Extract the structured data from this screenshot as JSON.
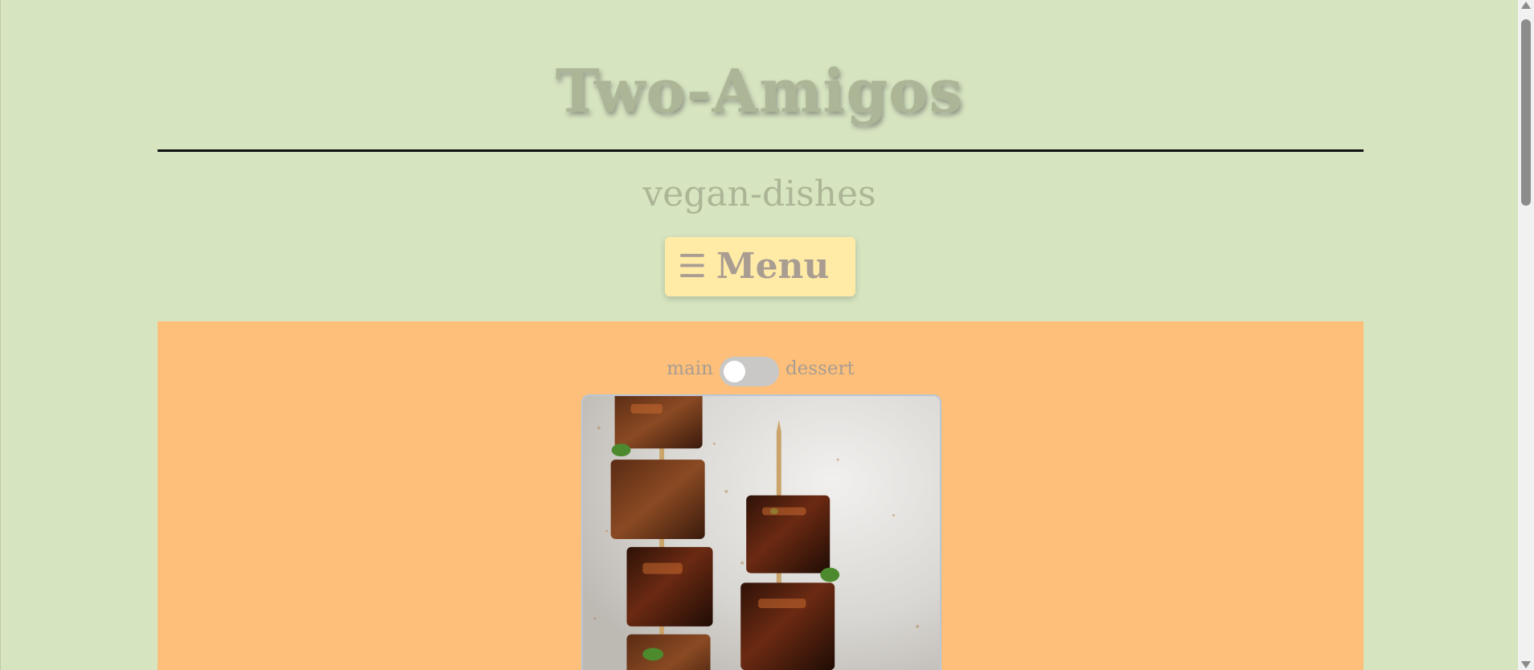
{
  "header": {
    "title": "Two-Amigos",
    "subtitle": "vegan-dishes"
  },
  "nav": {
    "menu_icon": "☰",
    "menu_label": "Menu"
  },
  "category_toggle": {
    "left_label": "main",
    "right_label": "dessert",
    "checked": false
  },
  "dish": {
    "image": "grilled-tofu-skewers-photo"
  },
  "colors": {
    "page_background": "#d6e4c0",
    "content_background": "#fdbf79",
    "menu_button_background": "#ffeaa6",
    "title_text": "#adb597",
    "menu_text": "#a99d92"
  },
  "icons": {
    "menu": "hamburger-icon",
    "scroll_up": "arrow-up-icon",
    "scroll_down": "arrow-down-icon"
  }
}
